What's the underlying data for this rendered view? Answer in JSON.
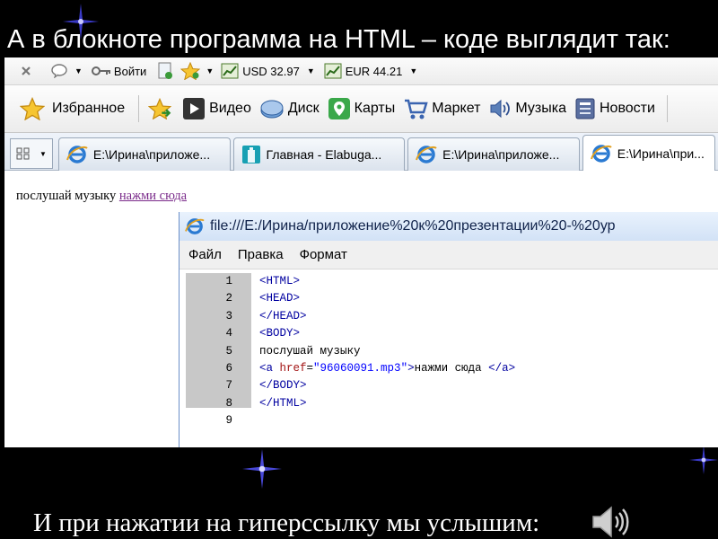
{
  "slide": {
    "title": "А в блокноте программа на HTML – коде выглядит так:",
    "caption": "И при нажатии на гиперссылку мы услышим:"
  },
  "browser": {
    "toolbar1": {
      "login": "Войти",
      "usd": "USD 32.97",
      "eur": "EUR 44.21"
    },
    "toolbar2": {
      "favorites": "Избранное",
      "links": [
        "Видео",
        "Диск",
        "Карты",
        "Маркет",
        "Музыка",
        "Новости"
      ]
    },
    "tabs": [
      {
        "label": "E:\\Ирина\\приложе...",
        "icon": "ie-icon",
        "active": false
      },
      {
        "label": "Главная - Elabuga...",
        "icon": "site-icon",
        "active": false
      },
      {
        "label": "E:\\Ирина\\приложе...",
        "icon": "ie-icon",
        "active": false
      },
      {
        "label": "E:\\Ирина\\при...",
        "icon": "ie-icon",
        "active": true
      }
    ],
    "page": {
      "text": "послушай музыку",
      "link": "нажми сюда"
    }
  },
  "notepad": {
    "title": "file:///E:/Ирина/приложение%20к%20презентации%20-%20ур",
    "menu": [
      "Файл",
      "Правка",
      "Формат"
    ],
    "lines": [
      {
        "n": "1",
        "parts": [
          {
            "t": "tag",
            "v": "<HTML>"
          }
        ]
      },
      {
        "n": "2",
        "parts": [
          {
            "t": "tag",
            "v": "<HEAD>"
          }
        ]
      },
      {
        "n": "3",
        "parts": [
          {
            "t": "tag",
            "v": "</HEAD>"
          }
        ]
      },
      {
        "n": "4",
        "parts": [
          {
            "t": "tag",
            "v": "<BODY>"
          }
        ]
      },
      {
        "n": "5",
        "parts": [
          {
            "t": "txt",
            "v": "послушай музыку"
          }
        ]
      },
      {
        "n": "6",
        "parts": [
          {
            "t": "tag",
            "v": "<a "
          },
          {
            "t": "attr",
            "v": "href"
          },
          {
            "t": "txt",
            "v": "="
          },
          {
            "t": "str",
            "v": "\"96060091.mp3\""
          },
          {
            "t": "tag",
            "v": ">"
          },
          {
            "t": "txt",
            "v": "нажми сюда "
          },
          {
            "t": "tag",
            "v": "</a>"
          }
        ]
      },
      {
        "n": "7",
        "parts": [
          {
            "t": "tag",
            "v": "</BODY>"
          }
        ]
      },
      {
        "n": "8",
        "parts": [
          {
            "t": "tag",
            "v": "</HTML>"
          }
        ]
      },
      {
        "n": "9",
        "parts": []
      }
    ]
  },
  "colors": {
    "slide_bg": "#000000",
    "slide_text": "#ffffff",
    "code_tag": "#0000a0",
    "code_attr": "#a31515",
    "code_string": "#0000ff",
    "link_visited": "#7a2a8a"
  }
}
